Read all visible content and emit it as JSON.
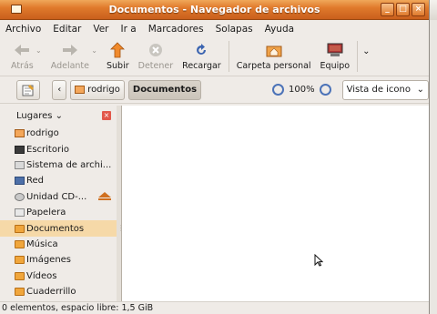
{
  "window": {
    "title": "Documentos - Navegador de archivos",
    "controls": [
      "_",
      "□",
      "×"
    ]
  },
  "menu": [
    "Archivo",
    "Editar",
    "Ver",
    "Ir a",
    "Marcadores",
    "Solapas",
    "Ayuda"
  ],
  "toolbar": {
    "back": "Atrás",
    "forward": "Adelante",
    "up": "Subir",
    "stop": "Detener",
    "reload": "Recargar",
    "home": "Carpeta personal",
    "computer": "Equipo"
  },
  "location": {
    "breadcrumb": [
      "rodrigo",
      "Documentos"
    ],
    "zoom": "100%",
    "view": "Vista de icono"
  },
  "sidebar": {
    "header": "Lugares",
    "items": [
      {
        "label": "rodrigo",
        "icon": "home-folder-icon"
      },
      {
        "label": "Escritorio",
        "icon": "desktop-icon"
      },
      {
        "label": "Sistema de archi...",
        "icon": "drive-icon"
      },
      {
        "label": "Red",
        "icon": "network-icon"
      },
      {
        "label": "Unidad CD-...",
        "icon": "cd-icon"
      },
      {
        "label": "Papelera",
        "icon": "trash-icon"
      },
      {
        "label": "Documentos",
        "icon": "folder-icon"
      },
      {
        "label": "Música",
        "icon": "folder-icon"
      },
      {
        "label": "Imágenes",
        "icon": "folder-icon"
      },
      {
        "label": "Vídeos",
        "icon": "folder-icon"
      },
      {
        "label": "Cuaderrillo",
        "icon": "folder-icon"
      }
    ]
  },
  "status": "0 elementos, espacio libre: 1,5 GiB"
}
